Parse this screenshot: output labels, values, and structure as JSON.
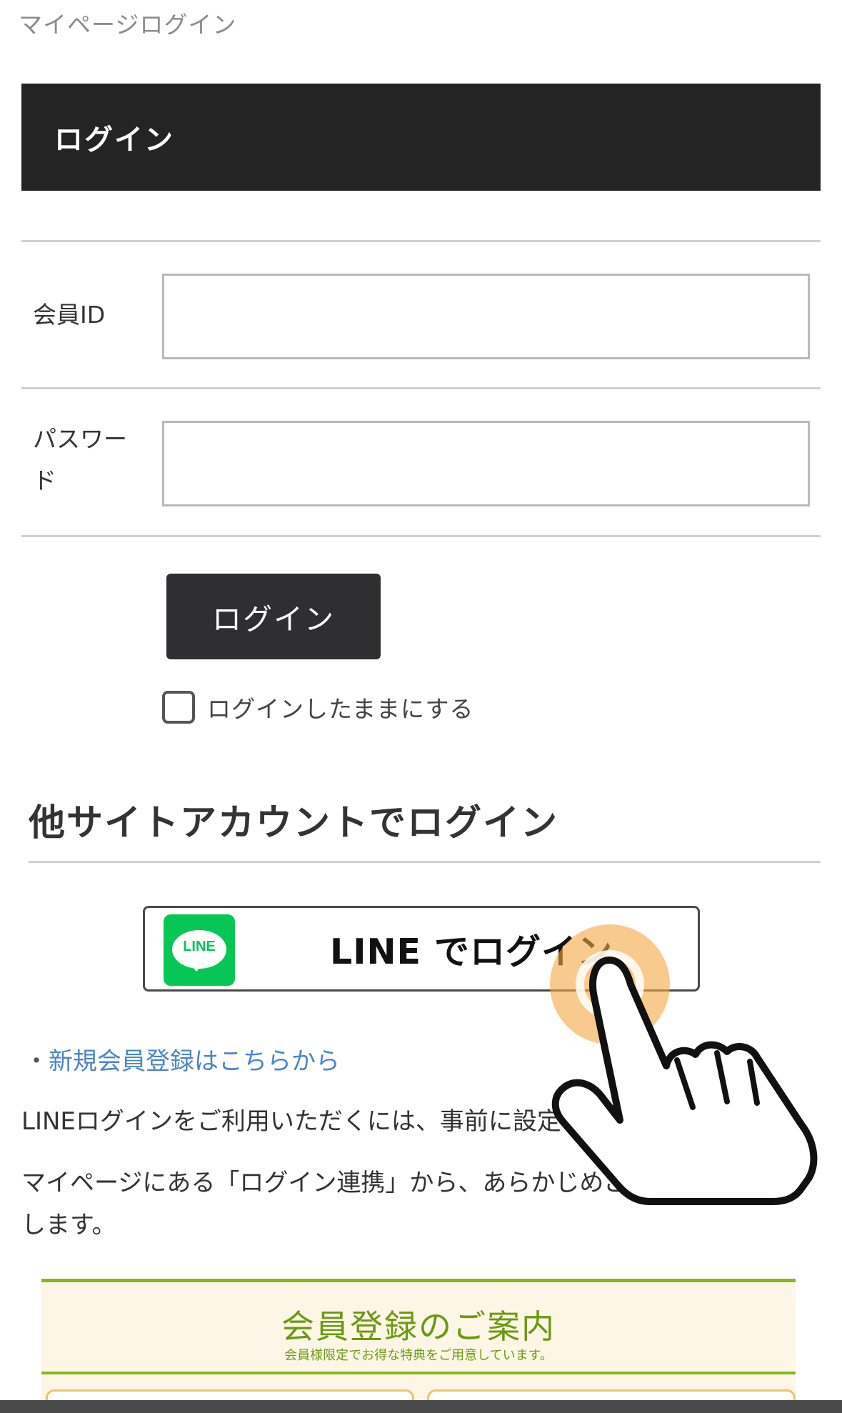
{
  "breadcrumb": "マイページログイン",
  "header": {
    "title": "ログイン"
  },
  "form": {
    "member_id_label": "会員ID",
    "member_id_value": "",
    "password_label_line1": "パスワー",
    "password_label_line2": "ド",
    "password_value": "",
    "login_button": "ログイン",
    "remember_label": "ログインしたままにする",
    "remember_checked": false
  },
  "social": {
    "section_title": "他サイトアカウントでログイン",
    "line_logo_text": "LINE",
    "line_button": "LINE でログイン"
  },
  "links": {
    "bullet": "・",
    "register": "新規会員登録はこちらから"
  },
  "info": {
    "line1": "LINEログインをご利用いただくには、事前に設定",
    "line2": "マイページにある「ログイン連携」から、あらかじめご登",
    "line3": "します。"
  },
  "banner": {
    "title": "会員登録のご案内",
    "subtitle": "会員様限定でお得な特典をご用意しています。"
  },
  "colors": {
    "header_bg": "#242424",
    "button_bg": "#2f2f31",
    "line_green": "#06c755",
    "link_blue": "#4a86c6",
    "banner_green": "#86b817",
    "tap_highlight": "#f5a742"
  },
  "icons": {
    "line_logo": "line-logo-icon",
    "tap_hand": "pointing-hand-icon"
  }
}
